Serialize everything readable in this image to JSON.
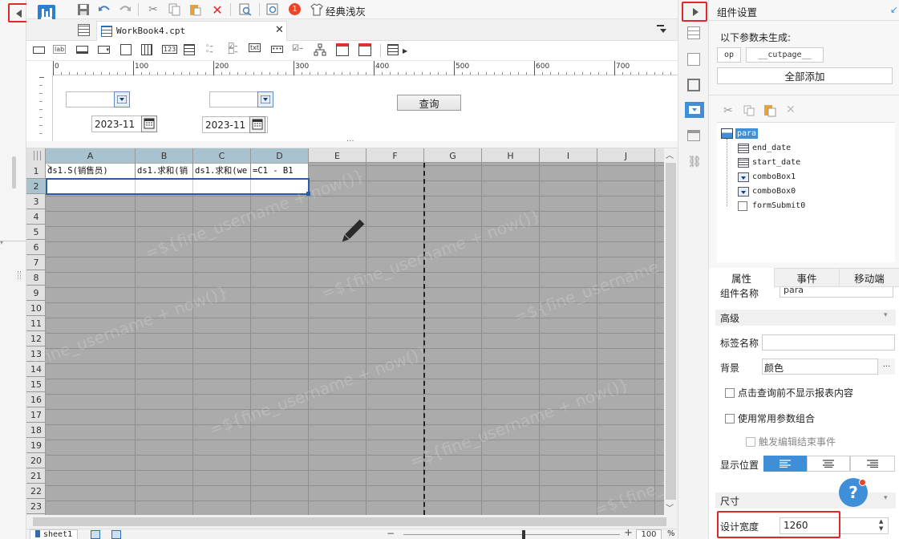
{
  "toolbar": {
    "theme_label": "经典浅灰",
    "badge_count": "1"
  },
  "tab": {
    "title": "WorkBook4.cpt"
  },
  "ruler": {
    "ticks": [
      "0",
      "100",
      "200",
      "300",
      "400",
      "500",
      "600",
      "700"
    ]
  },
  "param_panel": {
    "date1": "2023-11",
    "date2": "2023-11",
    "query_label": "查询",
    "ellipsis": "···"
  },
  "sheet": {
    "columns": [
      "A",
      "B",
      "C",
      "D",
      "E",
      "F",
      "G",
      "H",
      "I",
      "J"
    ],
    "rows": [
      "1",
      "2",
      "3",
      "4",
      "5",
      "6",
      "7",
      "8",
      "9",
      "10",
      "11",
      "12",
      "13",
      "14",
      "15",
      "16",
      "17",
      "18",
      "19",
      "20",
      "21",
      "22",
      "23"
    ],
    "cells": {
      "a1": "ds1.S(销售员)",
      "b1": "ds1.求和(销",
      "c1": "ds1.求和(we",
      "d1": "=C1 - B1"
    },
    "watermark": "=${fine_username + now()}"
  },
  "status": {
    "sheet_name": "sheet1",
    "zoom": "100",
    "percent": "%"
  },
  "right_panel": {
    "title": "组件设置",
    "missing_params_label": "以下参数未生成:",
    "param_chips": [
      "op",
      "__cutpage__"
    ],
    "add_all_label": "全部添加",
    "tree": [
      "para",
      "end_date",
      "start_date",
      "comboBox1",
      "comboBox0",
      "formSubmit0"
    ],
    "tabs": [
      "属性",
      "事件",
      "移动端"
    ],
    "component_name_label": "组件名称",
    "component_name_value": "para",
    "section_advanced": "高级",
    "tag_name_label": "标签名称",
    "bg_label": "背景",
    "bg_value": "颜色",
    "bg_more": "···",
    "check1": "点击查询前不显示报表内容",
    "check2": "使用常用参数组合",
    "check3": "触发编辑结束事件",
    "display_pos_label": "显示位置",
    "section_size": "尺寸",
    "design_width_label": "设计宽度",
    "design_width_value": "1260",
    "help": "?"
  }
}
